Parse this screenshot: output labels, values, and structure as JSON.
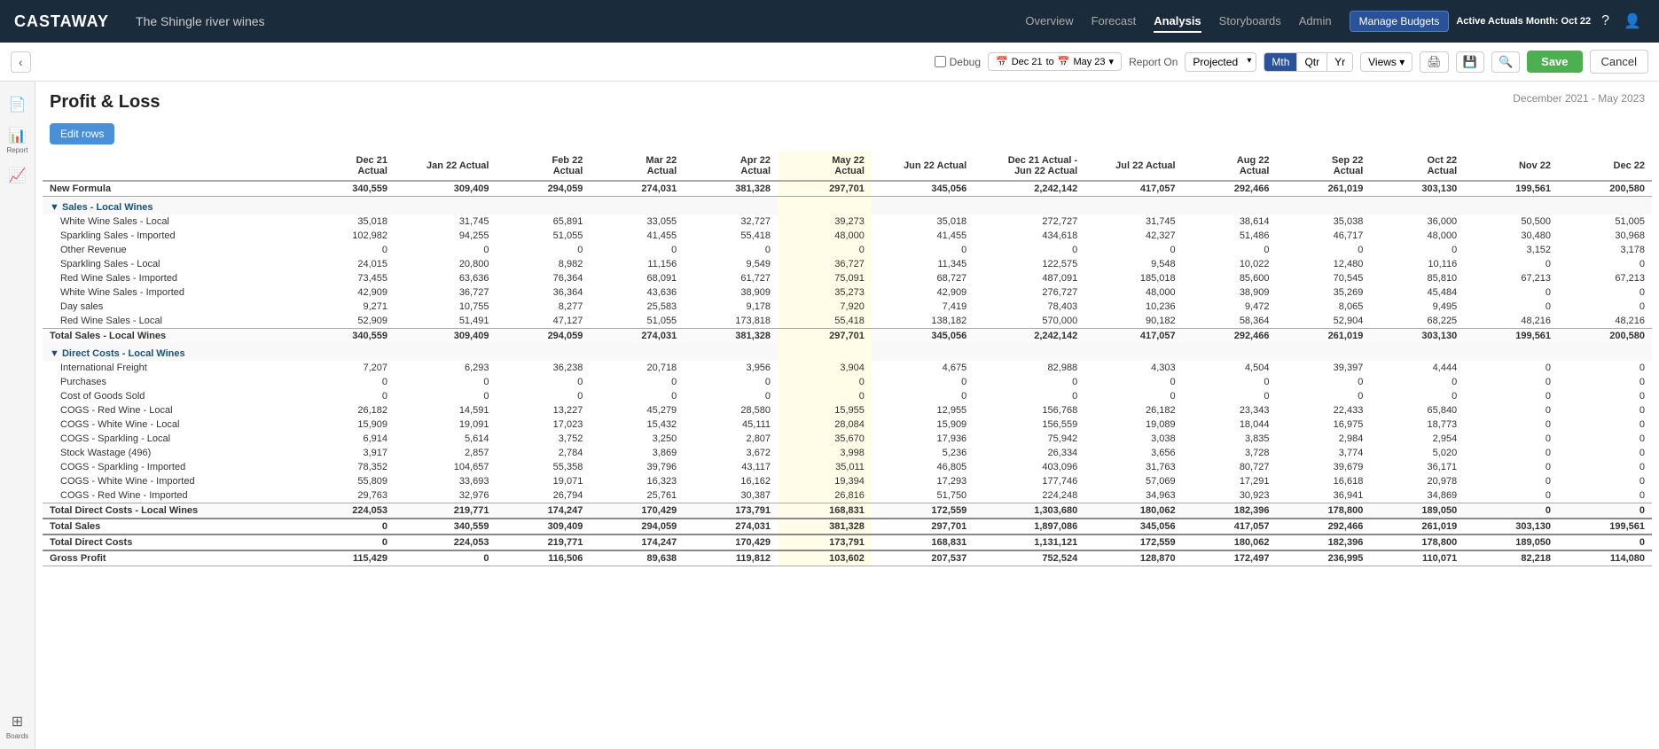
{
  "brand": "CASTAWAY",
  "project_name": "The Shingle river wines",
  "nav": {
    "links": [
      "Overview",
      "Forecast",
      "Analysis",
      "Storyboards",
      "Admin"
    ],
    "active": "Analysis"
  },
  "nav_right": {
    "manage_budgets": "Manage Budgets",
    "active_actuals": "Active Actuals Month:",
    "active_month": "Oct 22"
  },
  "toolbar": {
    "debug_label": "Debug",
    "date_from": "Dec 21",
    "date_to": "May 23",
    "report_on": "Report On",
    "projected": "Projected",
    "period_buttons": [
      "Mth",
      "Qtr",
      "Yr"
    ],
    "active_period": "Mth",
    "views_label": "Views",
    "save_label": "Save",
    "cancel_label": "Cancel"
  },
  "report": {
    "title": "Profit & Loss",
    "date_range": "December 2021 - May 2023",
    "edit_rows_label": "Edit rows"
  },
  "sidebar": {
    "icons": [
      {
        "name": "document-icon",
        "glyph": "📄",
        "label": ""
      },
      {
        "name": "report-icon",
        "glyph": "📊",
        "label": "Report"
      },
      {
        "name": "chart-icon",
        "glyph": "📈",
        "label": ""
      },
      {
        "name": "boards-icon",
        "glyph": "⊞",
        "label": "Boards"
      }
    ]
  },
  "table": {
    "columns": [
      {
        "id": "label",
        "header": "",
        "type": "label"
      },
      {
        "id": "dec21",
        "header": "Dec 21\nActual"
      },
      {
        "id": "jan22",
        "header": "Jan 22 Actual"
      },
      {
        "id": "feb22",
        "header": "Feb 22\nActual"
      },
      {
        "id": "mar22",
        "header": "Mar 22\nActual"
      },
      {
        "id": "apr22",
        "header": "Apr 22\nActual"
      },
      {
        "id": "may22",
        "header": "May 22\nActual"
      },
      {
        "id": "jun22",
        "header": "Jun 22 Actual"
      },
      {
        "id": "dec21_jun22",
        "header": "Dec 21 Actual -\nJun 22 Actual"
      },
      {
        "id": "jul22",
        "header": "Jul 22 Actual"
      },
      {
        "id": "aug22",
        "header": "Aug 22\nActual"
      },
      {
        "id": "sep22",
        "header": "Sep 22\nActual"
      },
      {
        "id": "oct22",
        "header": "Oct 22\nActual"
      },
      {
        "id": "nov22",
        "header": "Nov 22"
      },
      {
        "id": "dec22",
        "header": "Dec 22"
      }
    ],
    "rows": [
      {
        "type": "formula",
        "label": "New Formula",
        "values": [
          "340,559",
          "309,409",
          "294,059",
          "274,031",
          "381,328",
          "297,701",
          "345,056",
          "2,242,142",
          "417,057",
          "292,466",
          "261,019",
          "303,130",
          "199,561",
          "200,580"
        ]
      },
      {
        "type": "section-header",
        "label": "▼ Sales - Local Wines",
        "values": [
          "",
          "",
          "",
          "",
          "",
          "",
          "",
          "",
          "",
          "",
          "",
          "",
          "",
          ""
        ]
      },
      {
        "type": "data",
        "label": "White Wine Sales - Local",
        "indent": true,
        "values": [
          "35,018",
          "31,745",
          "65,891",
          "33,055",
          "32,727",
          "39,273",
          "35,018",
          "272,727",
          "31,745",
          "38,614",
          "35,038",
          "36,000",
          "50,500",
          "51,005"
        ]
      },
      {
        "type": "data",
        "label": "Sparkling Sales - Imported",
        "indent": true,
        "values": [
          "102,982",
          "94,255",
          "51,055",
          "41,455",
          "55,418",
          "48,000",
          "41,455",
          "434,618",
          "42,327",
          "51,486",
          "46,717",
          "48,000",
          "30,480",
          "30,968"
        ]
      },
      {
        "type": "data",
        "label": "Other Revenue",
        "indent": true,
        "values": [
          "0",
          "0",
          "0",
          "0",
          "0",
          "0",
          "0",
          "0",
          "0",
          "0",
          "0",
          "0",
          "3,152",
          "3,178"
        ]
      },
      {
        "type": "data",
        "label": "Sparkling Sales - Local",
        "indent": true,
        "values": [
          "24,015",
          "20,800",
          "8,982",
          "11,156",
          "9,549",
          "36,727",
          "11,345",
          "122,575",
          "9,548",
          "10,022",
          "12,480",
          "10,116",
          "0",
          "0"
        ]
      },
      {
        "type": "data",
        "label": "Red Wine Sales - Imported",
        "indent": true,
        "values": [
          "73,455",
          "63,636",
          "76,364",
          "68,091",
          "61,727",
          "75,091",
          "68,727",
          "487,091",
          "185,018",
          "85,600",
          "70,545",
          "85,810",
          "67,213",
          "67,213"
        ]
      },
      {
        "type": "data",
        "label": "White Wine Sales - Imported",
        "indent": true,
        "values": [
          "42,909",
          "36,727",
          "36,364",
          "43,636",
          "38,909",
          "35,273",
          "42,909",
          "276,727",
          "48,000",
          "38,909",
          "35,269",
          "45,484",
          "0",
          "0"
        ]
      },
      {
        "type": "data",
        "label": "Day sales",
        "indent": true,
        "values": [
          "9,271",
          "10,755",
          "8,277",
          "25,583",
          "9,178",
          "7,920",
          "7,419",
          "78,403",
          "10,236",
          "9,472",
          "8,065",
          "9,495",
          "0",
          "0"
        ]
      },
      {
        "type": "data",
        "label": "Red Wine Sales - Local",
        "indent": true,
        "values": [
          "52,909",
          "51,491",
          "47,127",
          "51,055",
          "173,818",
          "55,418",
          "138,182",
          "570,000",
          "90,182",
          "58,364",
          "52,904",
          "68,225",
          "48,216",
          "48,216"
        ]
      },
      {
        "type": "total",
        "label": "Total Sales - Local Wines",
        "values": [
          "340,559",
          "309,409",
          "294,059",
          "274,031",
          "381,328",
          "297,701",
          "345,056",
          "2,242,142",
          "417,057",
          "292,466",
          "261,019",
          "303,130",
          "199,561",
          "200,580"
        ]
      },
      {
        "type": "section-header",
        "label": "▼ Direct Costs - Local Wines",
        "values": [
          "",
          "",
          "",
          "",
          "",
          "",
          "",
          "",
          "",
          "",
          "",
          "",
          "",
          ""
        ]
      },
      {
        "type": "data",
        "label": "International Freight",
        "indent": true,
        "values": [
          "7,207",
          "6,293",
          "36,238",
          "20,718",
          "3,956",
          "3,904",
          "4,675",
          "82,988",
          "4,303",
          "4,504",
          "39,397",
          "4,444",
          "0",
          "0"
        ]
      },
      {
        "type": "data",
        "label": "Purchases",
        "indent": true,
        "values": [
          "0",
          "0",
          "0",
          "0",
          "0",
          "0",
          "0",
          "0",
          "0",
          "0",
          "0",
          "0",
          "0",
          "0"
        ]
      },
      {
        "type": "data",
        "label": "Cost of Goods Sold",
        "indent": true,
        "values": [
          "0",
          "0",
          "0",
          "0",
          "0",
          "0",
          "0",
          "0",
          "0",
          "0",
          "0",
          "0",
          "0",
          "0"
        ]
      },
      {
        "type": "data",
        "label": "COGS - Red Wine - Local",
        "indent": true,
        "values": [
          "26,182",
          "14,591",
          "13,227",
          "45,279",
          "28,580",
          "15,955",
          "12,955",
          "156,768",
          "26,182",
          "23,343",
          "22,433",
          "65,840",
          "0",
          "0"
        ]
      },
      {
        "type": "data",
        "label": "COGS - White Wine - Local",
        "indent": true,
        "values": [
          "15,909",
          "19,091",
          "17,023",
          "15,432",
          "45,111",
          "28,084",
          "15,909",
          "156,559",
          "19,089",
          "18,044",
          "16,975",
          "18,773",
          "0",
          "0"
        ]
      },
      {
        "type": "data",
        "label": "COGS - Sparkling - Local",
        "indent": true,
        "values": [
          "6,914",
          "5,614",
          "3,752",
          "3,250",
          "2,807",
          "35,670",
          "17,936",
          "75,942",
          "3,038",
          "3,835",
          "2,984",
          "2,954",
          "0",
          "0"
        ]
      },
      {
        "type": "data",
        "label": "Stock Wastage (496)",
        "indent": true,
        "values": [
          "3,917",
          "2,857",
          "2,784",
          "3,869",
          "3,672",
          "3,998",
          "5,236",
          "26,334",
          "3,656",
          "3,728",
          "3,774",
          "5,020",
          "0",
          "0"
        ]
      },
      {
        "type": "data",
        "label": "COGS - Sparkling - Imported",
        "indent": true,
        "values": [
          "78,352",
          "104,657",
          "55,358",
          "39,796",
          "43,117",
          "35,011",
          "46,805",
          "403,096",
          "31,763",
          "80,727",
          "39,679",
          "36,171",
          "0",
          "0"
        ]
      },
      {
        "type": "data",
        "label": "COGS - White Wine - Imported",
        "indent": true,
        "values": [
          "55,809",
          "33,693",
          "19,071",
          "16,323",
          "16,162",
          "19,394",
          "17,293",
          "177,746",
          "57,069",
          "17,291",
          "16,618",
          "20,978",
          "0",
          "0"
        ]
      },
      {
        "type": "data",
        "label": "COGS - Red Wine - Imported",
        "indent": true,
        "values": [
          "29,763",
          "32,976",
          "26,794",
          "25,761",
          "30,387",
          "26,816",
          "51,750",
          "224,248",
          "34,963",
          "30,923",
          "36,941",
          "34,869",
          "0",
          "0"
        ]
      },
      {
        "type": "total",
        "label": "Total Direct Costs - Local Wines",
        "values": [
          "224,053",
          "219,771",
          "174,247",
          "170,429",
          "173,791",
          "168,831",
          "172,559",
          "1,303,680",
          "180,062",
          "182,396",
          "178,800",
          "189,050",
          "0",
          "0"
        ]
      },
      {
        "type": "formula",
        "label": "Total Sales",
        "values": [
          "0",
          "340,559",
          "309,409",
          "294,059",
          "274,031",
          "381,328",
          "297,701",
          "1,897,086",
          "345,056",
          "417,057",
          "292,466",
          "261,019",
          "303,130",
          "199,561"
        ]
      },
      {
        "type": "formula",
        "label": "Total Direct Costs",
        "values": [
          "0",
          "224,053",
          "219,771",
          "174,247",
          "170,429",
          "173,791",
          "168,831",
          "1,131,121",
          "172,559",
          "180,062",
          "182,396",
          "178,800",
          "189,050",
          "0"
        ]
      },
      {
        "type": "formula",
        "label": "Gross Profit",
        "values": [
          "115,429",
          "0",
          "116,506",
          "89,638",
          "119,812",
          "103,602",
          "207,537",
          "752,524",
          "128,870",
          "172,497",
          "236,995",
          "110,071",
          "82,218",
          "114,080"
        ]
      }
    ]
  }
}
